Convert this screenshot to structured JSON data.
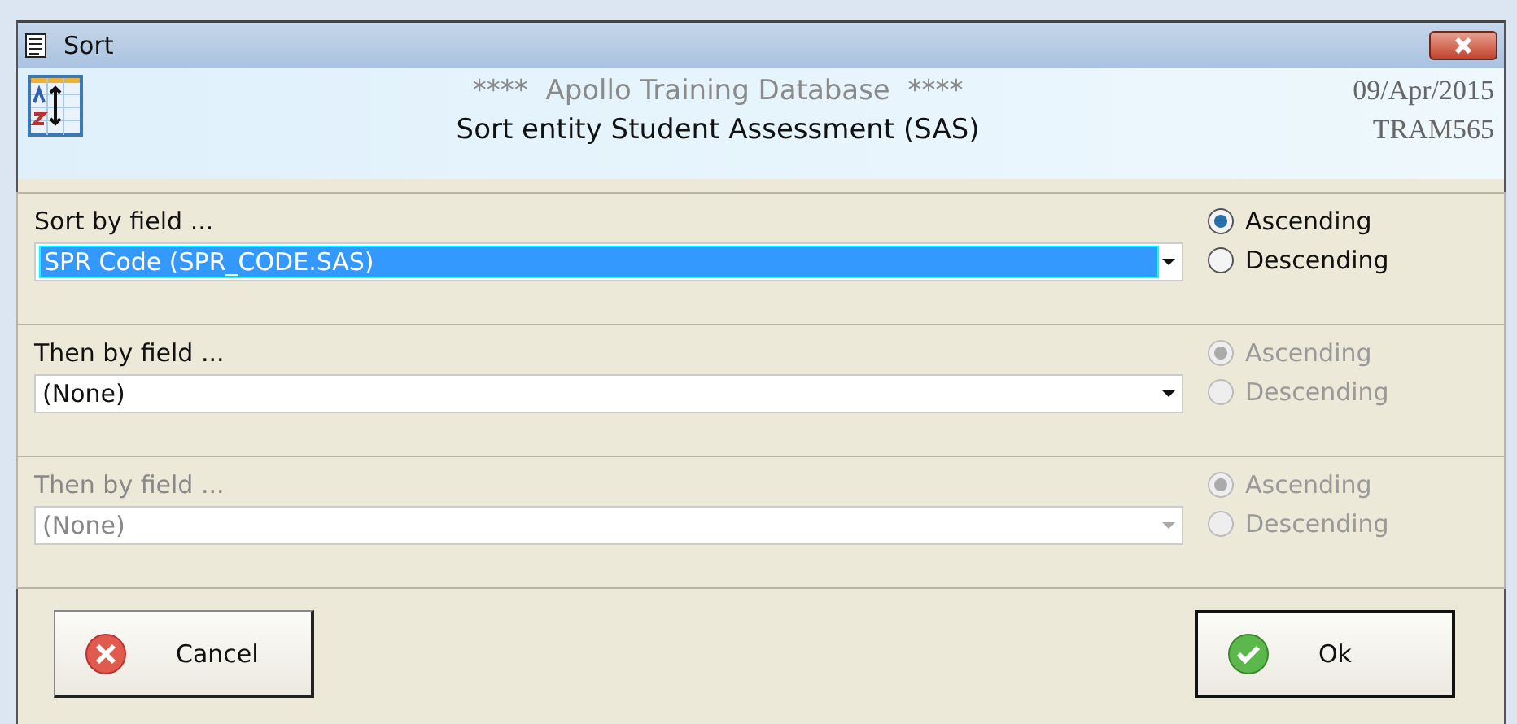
{
  "window": {
    "title": "Sort"
  },
  "header": {
    "database": "****  Apollo Training Database  ****",
    "entity": "Sort entity Student Assessment (SAS)",
    "date": "09/Apr/2015",
    "code": "TRAM565"
  },
  "sort_fields": [
    {
      "label": "Sort by field ...",
      "value": "SPR Code (SPR_CODE.SAS)",
      "highlighted": true,
      "disabled": false,
      "options": [
        {
          "label": "Ascending",
          "selected": true,
          "disabled": false
        },
        {
          "label": "Descending",
          "selected": false,
          "disabled": false
        }
      ]
    },
    {
      "label": "Then by field ...",
      "value": "(None)",
      "highlighted": false,
      "disabled": false,
      "options": [
        {
          "label": "Ascending",
          "selected": true,
          "disabled": true
        },
        {
          "label": "Descending",
          "selected": false,
          "disabled": true
        }
      ]
    },
    {
      "label": "Then by field ...",
      "value": "(None)",
      "highlighted": false,
      "disabled": true,
      "options": [
        {
          "label": "Ascending",
          "selected": true,
          "disabled": true
        },
        {
          "label": "Descending",
          "selected": false,
          "disabled": true
        }
      ]
    }
  ],
  "buttons": [
    {
      "label": "Cancel",
      "kind": "cancel"
    },
    {
      "label": "Ok",
      "kind": "ok"
    }
  ]
}
